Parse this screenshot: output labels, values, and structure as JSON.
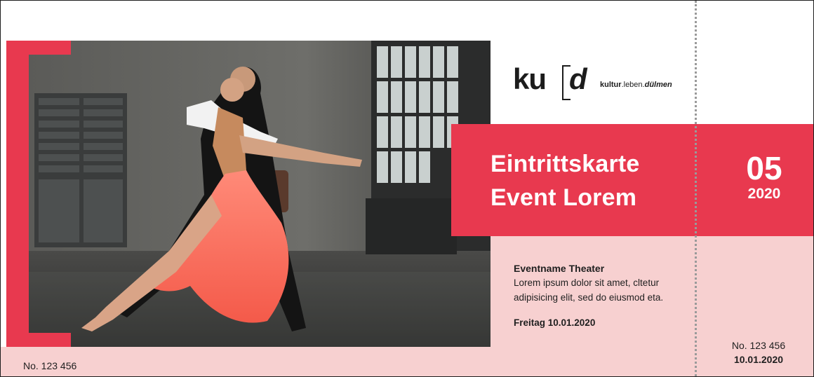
{
  "logo": {
    "mark_left": "ku",
    "mark_right": "d",
    "tagline_kultur": "kultur",
    "tagline_leben": ".leben.",
    "tagline_duelmen": "dülmen"
  },
  "ticket": {
    "title_line1": "Eintrittskarte",
    "title_line2": "Event Lorem",
    "day": "05",
    "year": "2020",
    "event_name": "Eventname Theater",
    "description": "Lorem ipsum dolor sit amet, cltetur adipisicing elit, sed do eiusmod eta.",
    "date_text": "Freitag 10.01.2020",
    "number": "No. 123 456"
  },
  "stub": {
    "number": "No. 123 456",
    "date": "10.01.2020"
  },
  "colors": {
    "accent": "#e8394f",
    "light_pink": "#f7d0d0"
  }
}
